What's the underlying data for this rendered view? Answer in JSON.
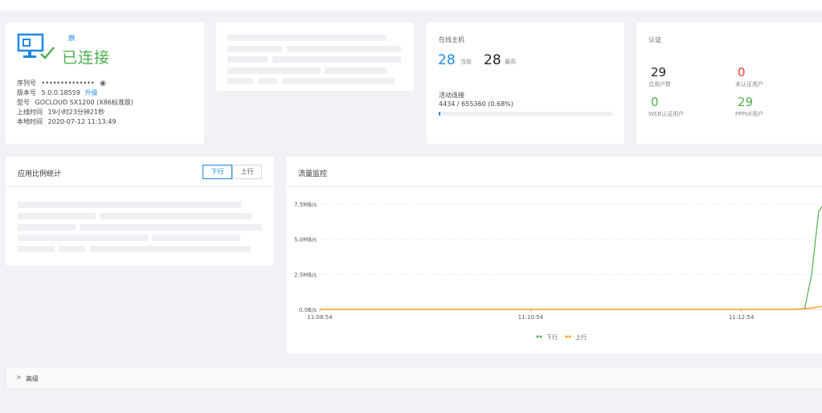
{
  "device": {
    "link_label": "覫",
    "status": "已连接",
    "rows": {
      "serial": {
        "label": "序列号",
        "value": "••••••••••••••"
      },
      "version": {
        "label": "版本号",
        "value": "5.0.0.18559",
        "action": "升级"
      },
      "model": {
        "label": "型号",
        "value": "GOCLOUD SX1200 (X86标准版)"
      },
      "uptime": {
        "label": "上线时间",
        "value": "19小时23分钟21秒"
      },
      "localtime": {
        "label": "本地时间",
        "value": "2020-07-12 11:13:49"
      }
    },
    "colors": {
      "status": "#4caf50",
      "icon": "#1e88e5"
    }
  },
  "hosts": {
    "title": "在线主机",
    "current": "28",
    "current_label": "当前",
    "max": "28",
    "max_label": "最高",
    "active_title": "活动连接",
    "active_value": "4434 / 655360 (0.68%)",
    "active_fraction": 0.0068
  },
  "auth": {
    "title": "认证",
    "total": {
      "value": "29",
      "label": "总用户数",
      "color": "#222222"
    },
    "unauth": {
      "value": "0",
      "label": "未认证用户",
      "color": "#e53935"
    },
    "web": {
      "value": "0",
      "label": "WEB认证用户",
      "color": "#4caf50"
    },
    "pppoe": {
      "value": "29",
      "label": "PPPoE用户",
      "color": "#4caf50"
    }
  },
  "app_ratio": {
    "title": "应用比例统计",
    "tab_down": "下行",
    "tab_up": "上行",
    "active_tab": "下行"
  },
  "traffic": {
    "title": "流量监控",
    "chart_data": {
      "type": "line",
      "title": "",
      "xlabel": "",
      "ylabel": "",
      "x_ticks": [
        "11:08:54",
        "11:10:54",
        "11:12:54"
      ],
      "y_ticks": [
        "0.0B/s",
        "2.5MB/s",
        "5.0MB/s",
        "7.5MB/s"
      ],
      "ylim": [
        0,
        8.3
      ],
      "xlim_seconds_from_start": [
        0,
        290
      ],
      "grid": true,
      "legend_position": "bottom",
      "series": [
        {
          "name": "下行",
          "color": "#4caf50",
          "x": [
            0,
            270,
            276,
            280,
            284,
            290
          ],
          "y": [
            0,
            0,
            0.05,
            2.5,
            7.0,
            8.0
          ]
        },
        {
          "name": "上行",
          "color": "#ff9800",
          "x": [
            0,
            270,
            280,
            290
          ],
          "y": [
            0,
            0,
            0.1,
            0.3
          ]
        }
      ]
    }
  },
  "advanced": {
    "arrow": ">",
    "label": "高级"
  }
}
